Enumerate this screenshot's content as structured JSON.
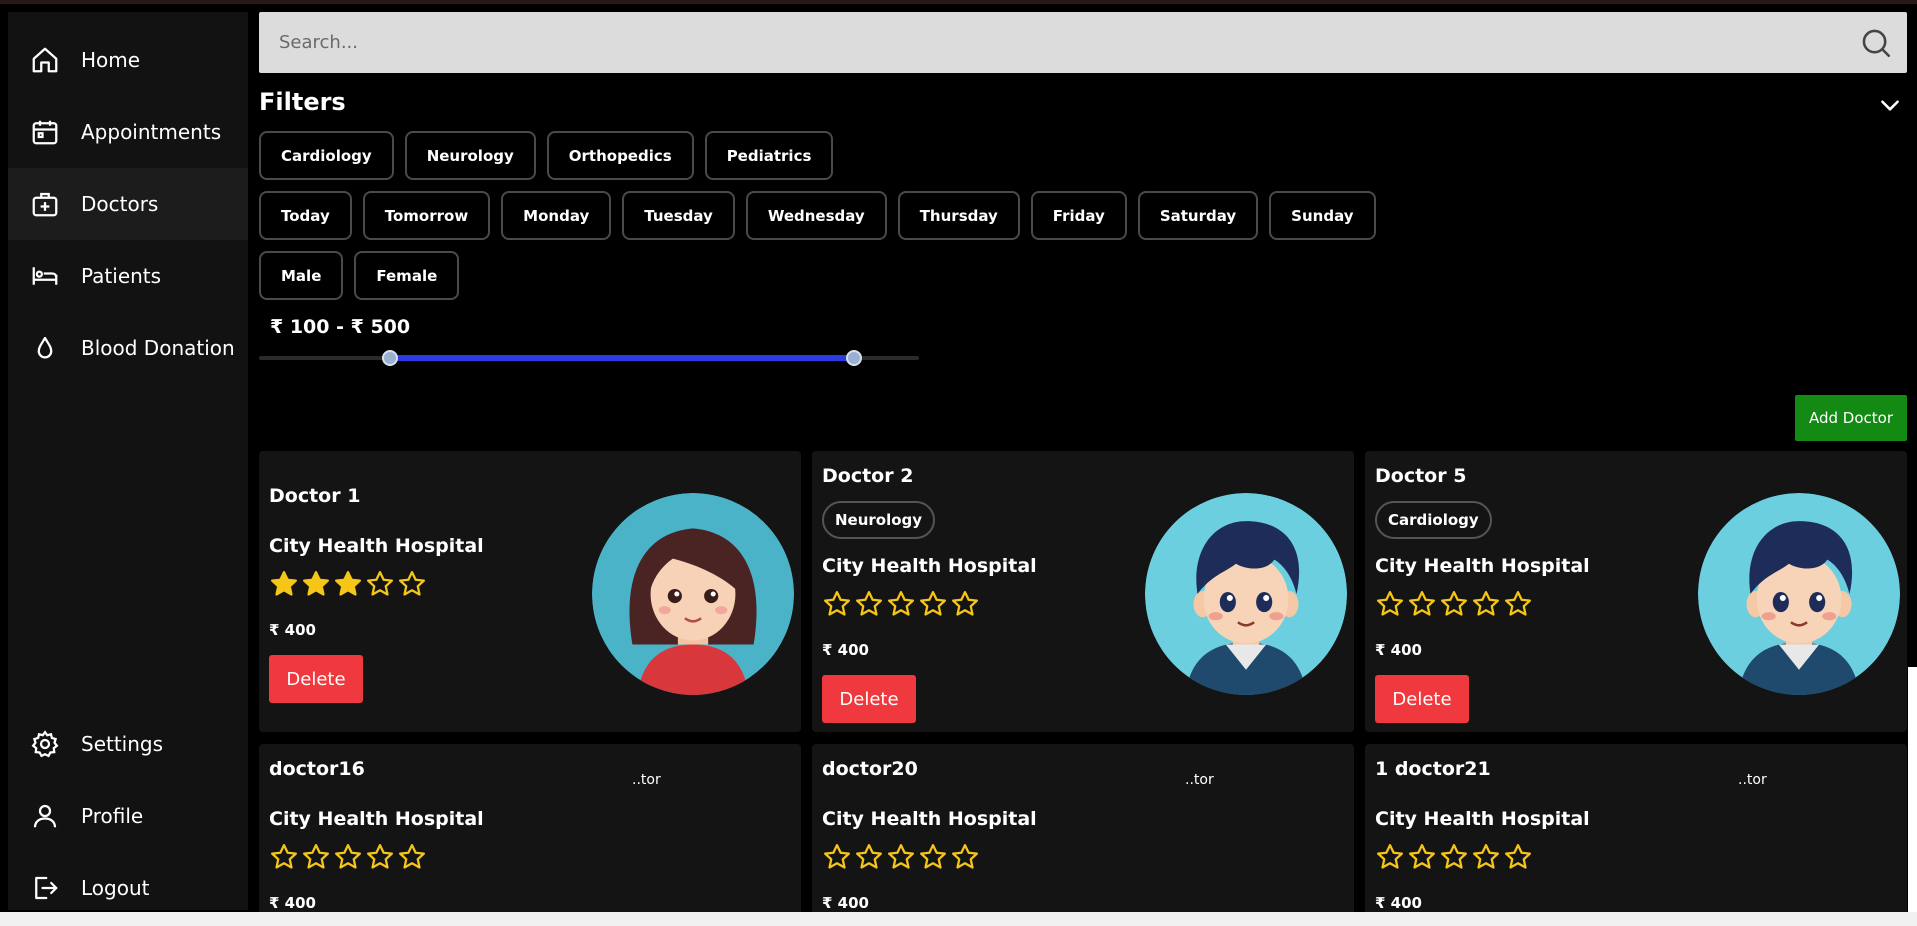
{
  "sidebar": {
    "items": [
      {
        "label": "Home",
        "icon": "home-icon"
      },
      {
        "label": "Appointments",
        "icon": "calendar-icon"
      },
      {
        "label": "Doctors",
        "icon": "medical-bag-icon",
        "active": true
      },
      {
        "label": "Patients",
        "icon": "bed-icon"
      },
      {
        "label": "Blood Donation",
        "icon": "blood-drop-icon"
      }
    ],
    "bottom_items": [
      {
        "label": "Settings",
        "icon": "gear-icon"
      },
      {
        "label": "Profile",
        "icon": "user-icon"
      },
      {
        "label": "Logout",
        "icon": "logout-icon"
      }
    ]
  },
  "search": {
    "placeholder": "Search...",
    "value": ""
  },
  "filters": {
    "title": "Filters",
    "specialties": [
      "Cardiology",
      "Neurology",
      "Orthopedics",
      "Pediatrics"
    ],
    "days": [
      "Today",
      "Tomorrow",
      "Monday",
      "Tuesday",
      "Wednesday",
      "Thursday",
      "Friday",
      "Saturday",
      "Sunday"
    ],
    "genders": [
      "Male",
      "Female"
    ],
    "price": {
      "label": "₹ 100 - ₹ 500",
      "min": 100,
      "max": 500,
      "range_min": 0,
      "range_max": 1000
    }
  },
  "add_doctor_label": "Add Doctor",
  "delete_label": "Delete",
  "doctors": [
    {
      "name": "Doctor 1",
      "specialty": "",
      "hospital": "City Health Hospital",
      "rating": 3,
      "fee": "₹ 400",
      "avatar": "female",
      "show_delete": true
    },
    {
      "name": "Doctor 2",
      "specialty": "Neurology",
      "hospital": "City Health Hospital",
      "rating": 0,
      "fee": "₹ 400",
      "avatar": "male",
      "show_delete": true
    },
    {
      "name": "Doctor 5",
      "specialty": "Cardiology",
      "hospital": "City Health Hospital",
      "rating": 0,
      "fee": "₹ 400",
      "avatar": "male",
      "show_delete": true
    },
    {
      "name": "doctor16",
      "specialty": "",
      "hospital": "City Health Hospital",
      "rating": 0,
      "fee": "₹ 400",
      "avatar": "broken",
      "alt": "..tor",
      "show_delete": false
    },
    {
      "name": "doctor20",
      "specialty": "",
      "hospital": "City Health Hospital",
      "rating": 0,
      "fee": "₹ 400",
      "avatar": "broken",
      "alt": "..tor",
      "show_delete": false
    },
    {
      "name": "1 doctor21",
      "specialty": "",
      "hospital": "City Health Hospital",
      "rating": 0,
      "fee": "₹ 400",
      "avatar": "broken",
      "alt": "..tor",
      "show_delete": false
    }
  ],
  "colors": {
    "accent_blue": "#2d3be6",
    "delete_red": "#f0393e",
    "add_green": "#138a13",
    "star_gold": "#f5c518"
  }
}
